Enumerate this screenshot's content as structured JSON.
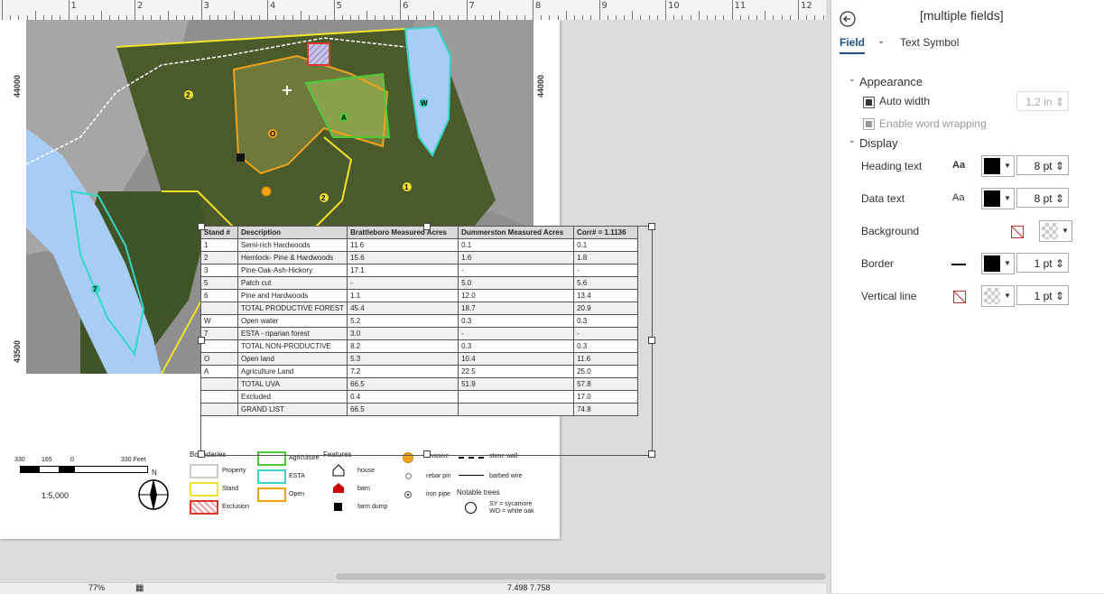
{
  "ruler": {
    "numbers": [
      "1",
      "2",
      "3",
      "4",
      "5",
      "6",
      "7",
      "8",
      "9",
      "10",
      "11",
      "12"
    ]
  },
  "map": {
    "coord_left_top": "44000",
    "coord_right_top": "44000",
    "coord_left_bottom": "43500",
    "labels": [
      "W",
      "A",
      "O",
      "2",
      "1",
      "2",
      "7"
    ],
    "colors": {
      "stand": "#f1e22b",
      "agriculture": "#4ccb3a",
      "esta": "#36d6c8",
      "open": "#f0a21c",
      "water": "#a8cdf5",
      "exclusion": "#d93a2b"
    }
  },
  "table": {
    "headers": [
      "Stand #",
      "Description",
      "Brattleboro Measured Acres",
      "Dummerston Measured Acres",
      "Corr# = 1.1136"
    ],
    "rows": [
      [
        "1",
        "Semi-rich Hardwoods",
        "11.6",
        "0.1",
        "0.1"
      ],
      [
        "2",
        "Hemlock- Pine & Hardwoods",
        "15.6",
        "1.6",
        "1.8"
      ],
      [
        "3",
        "Pine-Oak-Ash-Hickory",
        "17.1",
        "-",
        "-"
      ],
      [
        "5",
        "Patch cut",
        "-",
        "5.0",
        "5.6"
      ],
      [
        "6",
        "Pine and Hardwoods",
        "1.1",
        "12.0",
        "13.4"
      ],
      [
        "",
        "TOTAL PRODUCTIVE  FOREST",
        "45.4",
        "18.7",
        "20.9"
      ],
      [
        "W",
        "Open water",
        "5.2",
        "0.3",
        "0.3"
      ],
      [
        "7",
        "ESTA - riparian forest",
        "3.0",
        "-",
        "-"
      ],
      [
        "",
        "TOTAL NON-PRODUCTIVE",
        "8.2",
        "0.3",
        "0.3"
      ],
      [
        "O",
        "Open land",
        "5.3",
        "10.4",
        "11.6"
      ],
      [
        "A",
        "Agriculture Land",
        "7.2",
        "22.5",
        "25.0"
      ],
      [
        "",
        "TOTAL UVA",
        "66.5",
        "51.9",
        "57.8"
      ],
      [
        "",
        "Excluded",
        "0.4",
        "",
        "17.0"
      ],
      [
        "",
        "GRAND LIST",
        "66.5",
        "",
        "74.8"
      ]
    ]
  },
  "legend": {
    "scale_labels": [
      "330",
      "165",
      "0",
      "330 Feet"
    ],
    "north": "N",
    "scale_ratio": "1:5,000",
    "boundaries_title": "Boundaries",
    "property": "Property",
    "stand": "Stand",
    "exclusion": "Exclusion",
    "agriculture": "Agriculture",
    "esta": "ESTA",
    "open": "Open",
    "features_title": "Features",
    "house": "house",
    "barn": "barn",
    "farm_dump": "farm dump",
    "invasive": "invasive",
    "rebar_pin": "rebar pin",
    "iron_pipe": "iron pipe",
    "stone_wall": "stone wall",
    "barbed_wire": "barbed wire",
    "notable_trees": "Notable trees",
    "trees_note1": "SY = sycamore",
    "trees_note2": "WO = white oak"
  },
  "status": {
    "zoom": "77%",
    "coords": "7.498  7.758"
  },
  "pane": {
    "title": "[multiple fields]",
    "tab_field": "Field",
    "tab_text_symbol": "Text Symbol",
    "appearance": "Appearance",
    "auto_width": "Auto width",
    "auto_width_value": "1.2 in",
    "enable_wrap": "Enable word wrapping",
    "display": "Display",
    "heading_text": "Heading text",
    "heading_size": "8 pt",
    "data_text": "Data text",
    "data_size": "8 pt",
    "background": "Background",
    "border": "Border",
    "border_size": "1 pt",
    "vertical_line": "Vertical line",
    "vline_size": "1 pt",
    "aa": "Aa"
  }
}
